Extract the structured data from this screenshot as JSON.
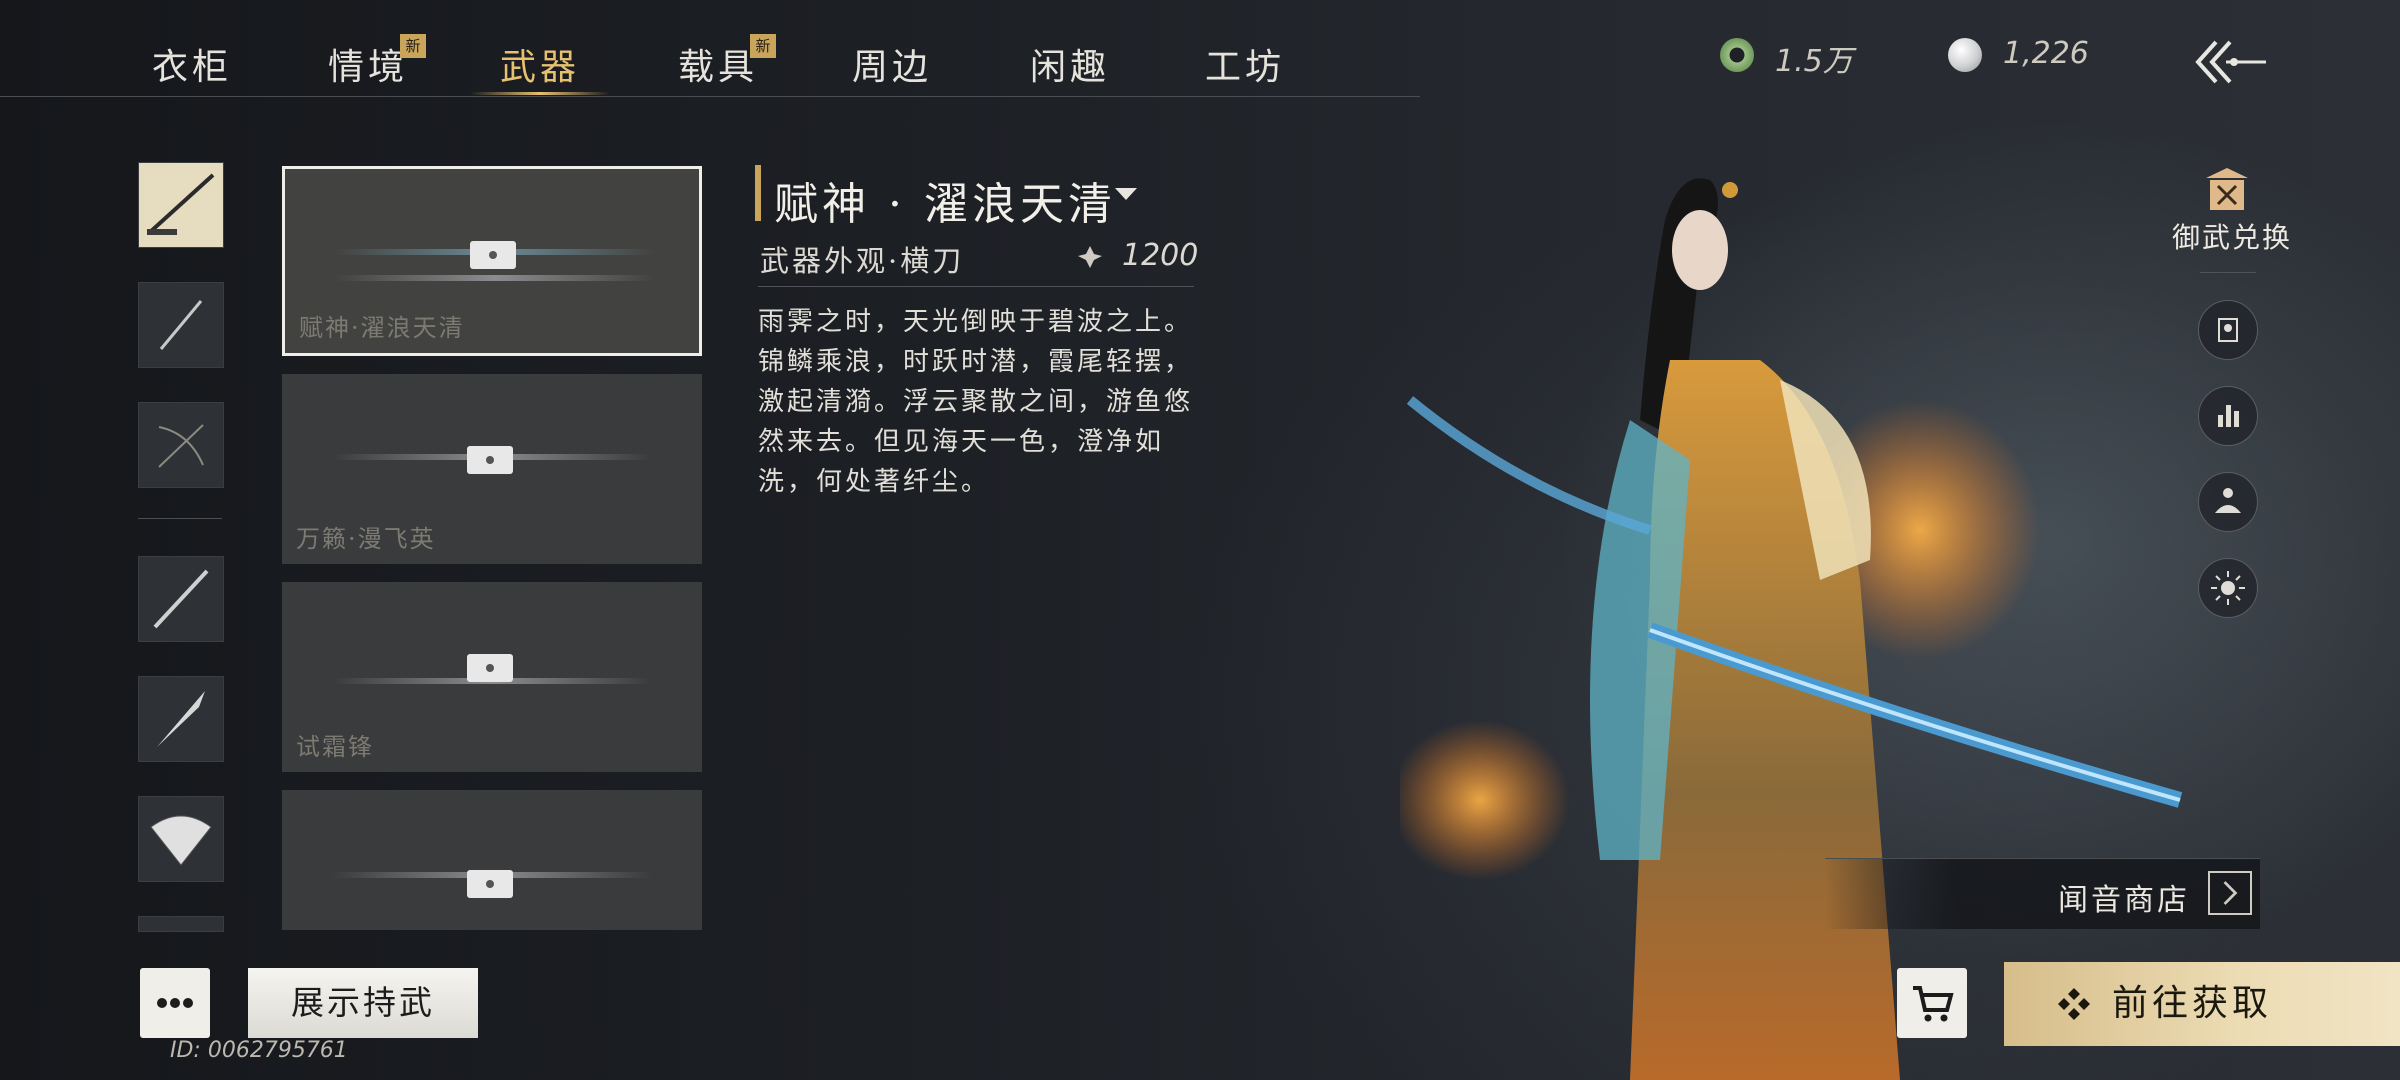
{
  "nav": {
    "tabs": [
      {
        "label": "衣柜",
        "badge": ""
      },
      {
        "label": "情境",
        "badge": "新"
      },
      {
        "label": "武器",
        "badge": "",
        "active": true
      },
      {
        "label": "载具",
        "badge": "新"
      },
      {
        "label": "周边",
        "badge": ""
      },
      {
        "label": "闲趣",
        "badge": ""
      },
      {
        "label": "工坊",
        "badge": ""
      }
    ]
  },
  "currency": {
    "jade": {
      "icon": "jade-coin-icon",
      "amount": "1.5万"
    },
    "pearl": {
      "icon": "pearl-icon",
      "amount": "1,226"
    }
  },
  "weapon_cards": [
    {
      "name": "赋神·濯浪天清",
      "selected": true
    },
    {
      "name": "万籁·漫飞英",
      "selected": false
    },
    {
      "name": "试霜锋",
      "selected": false
    },
    {
      "name": "",
      "selected": false
    }
  ],
  "detail": {
    "title": "赋神 · 濯浪天清",
    "subtitle": "武器外观·横刀",
    "price": "1200",
    "price_icon": "currency-flower-icon",
    "description": "雨霁之时，天光倒映于碧波之上。\n锦鳞乘浪，时跃时潜，霞尾轻摆，\n激起清漪。浮云聚散之间，游鱼悠\n然来去。但见海天一色，澄净如\n洗，何处著纤尘。"
  },
  "side": {
    "exchange_label": "御武兑换",
    "buttons": [
      "portrait-icon",
      "bar-chart-icon",
      "pose-icon",
      "light-icon"
    ]
  },
  "shop": {
    "label": "闻音商店"
  },
  "bottom": {
    "show_label": "展示持武",
    "user_id": "ID: 0062795761",
    "get_label": "前往获取"
  },
  "colors": {
    "accent_gold": "#e7c170",
    "badge": "#c9a55c",
    "button_gold": "#ecdcb4"
  }
}
